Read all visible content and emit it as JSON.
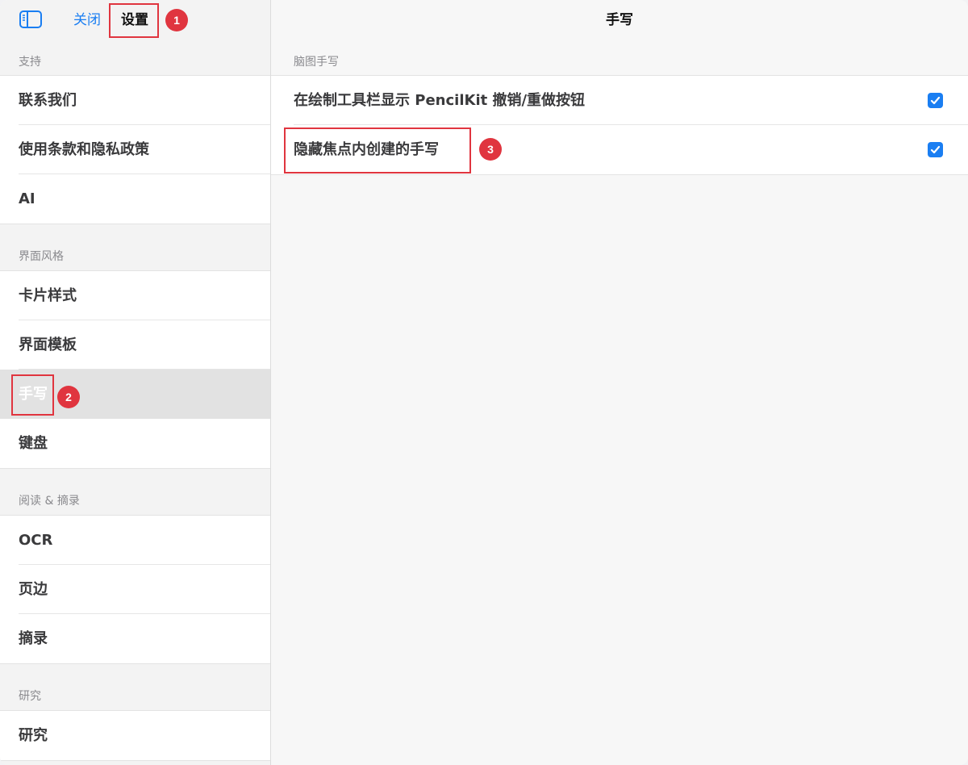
{
  "sidebar": {
    "toolbar": {
      "toggle_icon": "sidebar-toggle-icon",
      "close_label": "关闭",
      "title": "设置"
    },
    "sections": [
      {
        "header": "支持",
        "items": [
          {
            "label": "联系我们"
          },
          {
            "label": "使用条款和隐私政策"
          },
          {
            "label": "AI"
          }
        ]
      },
      {
        "header": "界面风格",
        "items": [
          {
            "label": "卡片样式"
          },
          {
            "label": "界面模板"
          },
          {
            "label": "手写",
            "selected": true
          },
          {
            "label": "键盘"
          }
        ]
      },
      {
        "header": "阅读 & 摘录",
        "items": [
          {
            "label": "OCR"
          },
          {
            "label": "页边"
          },
          {
            "label": "摘录"
          }
        ]
      },
      {
        "header": "研究",
        "items": [
          {
            "label": "研究"
          }
        ]
      }
    ]
  },
  "detail": {
    "title": "手写",
    "section_header": "脑图手写",
    "options": [
      {
        "label": "在绘制工具栏显示 PencilKit 撤销/重做按钮",
        "checked": true
      },
      {
        "label": "隐藏焦点内创建的手写",
        "checked": true
      }
    ]
  },
  "annotations": {
    "badges": [
      "1",
      "2",
      "3"
    ],
    "color": "#e0353f"
  },
  "colors": {
    "accent": "#1a7ef2",
    "highlight": "#e0353f"
  }
}
